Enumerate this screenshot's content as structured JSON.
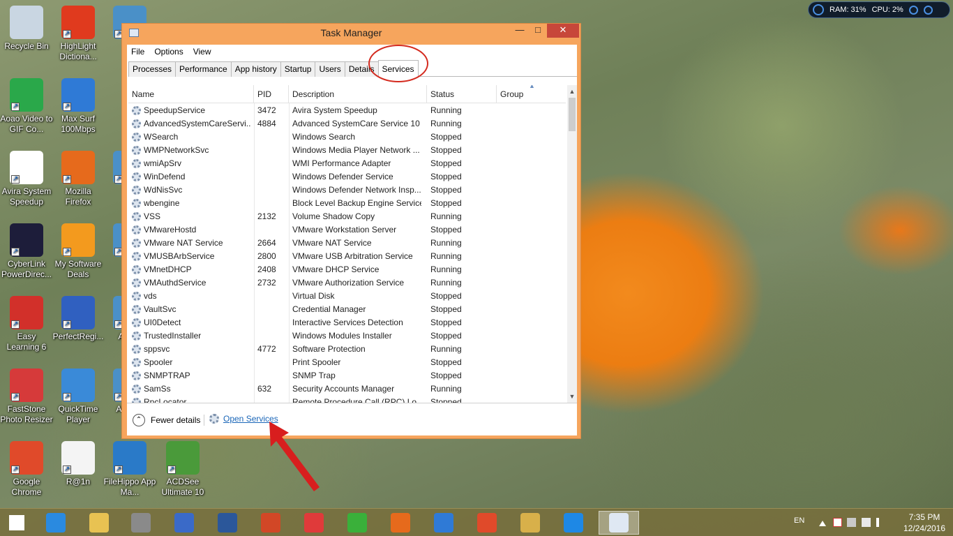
{
  "desktop": {
    "icons": [
      {
        "label": "Recycle Bin",
        "color": "#c9d6e2"
      },
      {
        "label": "HighLight Dictiona...",
        "color": "#e03a1e"
      },
      {
        "label": "Un",
        "color": "#4a90c8"
      },
      {
        "label": "Aoao Video to GIF Co...",
        "color": "#2aa84a"
      },
      {
        "label": "Max Surf 100Mbps",
        "color": "#2f7ad6"
      },
      {
        "label": "Avira System Speedup",
        "color": "#ffffff"
      },
      {
        "label": "Mozilla Firefox",
        "color": "#e66a1c"
      },
      {
        "label": "U S",
        "color": "#4a90c8"
      },
      {
        "label": "CyberLink PowerDirec...",
        "color": "#1d1d3a"
      },
      {
        "label": "My Software Deals",
        "color": "#f39a1e"
      },
      {
        "label": "Na",
        "color": "#4a90c8"
      },
      {
        "label": "Easy Learning 6",
        "color": "#d2302a"
      },
      {
        "label": "PerfectRegi...",
        "color": "#3060c0"
      },
      {
        "label": "Ar Scr",
        "color": "#4a90c8"
      },
      {
        "label": "FastStone Photo Resizer",
        "color": "#d63a3a"
      },
      {
        "label": "QuickTime Player",
        "color": "#3a8ad8"
      },
      {
        "label": "Au Boo",
        "color": "#4a90c8"
      },
      {
        "label": "Google Chrome",
        "color": "#e04a2a"
      },
      {
        "label": "R@1n",
        "color": "#f4f4f4"
      },
      {
        "label": "FileHippo App Ma...",
        "color": "#2a7ac8"
      },
      {
        "label": "ACDSee Ultimate 10",
        "color": "#4a9a3a"
      }
    ]
  },
  "gadget": {
    "ram": "RAM: 31%",
    "cpu": "CPU: 2%"
  },
  "window": {
    "title": "Task Manager",
    "minimize": "—",
    "maximize": "□",
    "close": "✕",
    "menu": [
      "File",
      "Options",
      "View"
    ],
    "tabs": [
      "Processes",
      "Performance",
      "App history",
      "Startup",
      "Users",
      "Details",
      "Services"
    ],
    "active_tab": "Services",
    "columns": {
      "name": "Name",
      "pid": "PID",
      "description": "Description",
      "status": "Status",
      "group": "Group"
    },
    "rows": [
      {
        "name": "SpeedupService",
        "pid": "3472",
        "desc": "Avira System Speedup",
        "status": "Running"
      },
      {
        "name": "AdvancedSystemCareServi...",
        "pid": "4884",
        "desc": "Advanced SystemCare Service 10",
        "status": "Running"
      },
      {
        "name": "WSearch",
        "pid": "",
        "desc": "Windows Search",
        "status": "Stopped"
      },
      {
        "name": "WMPNetworkSvc",
        "pid": "",
        "desc": "Windows Media Player Network ...",
        "status": "Stopped"
      },
      {
        "name": "wmiApSrv",
        "pid": "",
        "desc": "WMI Performance Adapter",
        "status": "Stopped"
      },
      {
        "name": "WinDefend",
        "pid": "",
        "desc": "Windows Defender Service",
        "status": "Stopped"
      },
      {
        "name": "WdNisSvc",
        "pid": "",
        "desc": "Windows Defender Network Insp...",
        "status": "Stopped"
      },
      {
        "name": "wbengine",
        "pid": "",
        "desc": "Block Level Backup Engine Service",
        "status": "Stopped"
      },
      {
        "name": "VSS",
        "pid": "2132",
        "desc": "Volume Shadow Copy",
        "status": "Running"
      },
      {
        "name": "VMwareHostd",
        "pid": "",
        "desc": "VMware Workstation Server",
        "status": "Stopped"
      },
      {
        "name": "VMware NAT Service",
        "pid": "2664",
        "desc": "VMware NAT Service",
        "status": "Running"
      },
      {
        "name": "VMUSBArbService",
        "pid": "2800",
        "desc": "VMware USB Arbitration Service",
        "status": "Running"
      },
      {
        "name": "VMnetDHCP",
        "pid": "2408",
        "desc": "VMware DHCP Service",
        "status": "Running"
      },
      {
        "name": "VMAuthdService",
        "pid": "2732",
        "desc": "VMware Authorization Service",
        "status": "Running"
      },
      {
        "name": "vds",
        "pid": "",
        "desc": "Virtual Disk",
        "status": "Stopped"
      },
      {
        "name": "VaultSvc",
        "pid": "",
        "desc": "Credential Manager",
        "status": "Stopped"
      },
      {
        "name": "UI0Detect",
        "pid": "",
        "desc": "Interactive Services Detection",
        "status": "Stopped"
      },
      {
        "name": "TrustedInstaller",
        "pid": "",
        "desc": "Windows Modules Installer",
        "status": "Stopped"
      },
      {
        "name": "sppsvc",
        "pid": "4772",
        "desc": "Software Protection",
        "status": "Running"
      },
      {
        "name": "Spooler",
        "pid": "",
        "desc": "Print Spooler",
        "status": "Stopped"
      },
      {
        "name": "SNMPTRAP",
        "pid": "",
        "desc": "SNMP Trap",
        "status": "Stopped"
      },
      {
        "name": "SamSs",
        "pid": "632",
        "desc": "Security Accounts Manager",
        "status": "Running"
      },
      {
        "name": "RpcLocator",
        "pid": "",
        "desc": "Remote Procedure Call (RPC) Lo...",
        "status": "Stopped"
      }
    ],
    "footer": {
      "fewer_details": "Fewer details",
      "open_services": "Open Services"
    }
  },
  "taskbar": {
    "apps": [
      {
        "name": "start",
        "color": "#ffffff"
      },
      {
        "name": "internet-explorer",
        "color": "#2a8ae0"
      },
      {
        "name": "file-explorer",
        "color": "#e8c252"
      },
      {
        "name": "firewall",
        "color": "#8a8a8a"
      },
      {
        "name": "abc",
        "color": "#3a6ac8"
      },
      {
        "name": "word",
        "color": "#2b579a"
      },
      {
        "name": "powerpoint",
        "color": "#d24726"
      },
      {
        "name": "picpick",
        "color": "#e03a3a"
      },
      {
        "name": "terminal",
        "color": "#3ab03a"
      },
      {
        "name": "firefox",
        "color": "#e66a1c"
      },
      {
        "name": "max-surf",
        "color": "#2f7ad6"
      },
      {
        "name": "chrome",
        "color": "#e04a2a"
      },
      {
        "name": "paint",
        "color": "#d8b04a"
      },
      {
        "name": "advanced-systemcare",
        "color": "#1e88e5"
      },
      {
        "name": "task-manager",
        "color": "#dfe8f3"
      }
    ],
    "lang": "EN",
    "time": "7:35 PM",
    "date": "12/24/2016"
  }
}
